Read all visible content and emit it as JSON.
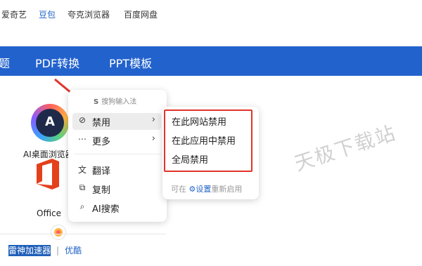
{
  "top_links": [
    {
      "label": "爱奇艺",
      "active": false
    },
    {
      "label": "豆包",
      "active": true
    },
    {
      "label": "夸克浏览器",
      "active": false
    },
    {
      "label": "百度网盘",
      "active": false
    }
  ],
  "nav": {
    "items": [
      "题",
      "PDF转换",
      "PPT模板"
    ],
    "color": "#2262cd"
  },
  "apps": [
    {
      "label": "AI桌面浏览器",
      "icon": "ai-browser-icon"
    },
    {
      "label": "Office",
      "icon": "office-icon"
    }
  ],
  "bottom_links": {
    "highlighted": "雷神加速器",
    "separator": "|",
    "link": "优酷"
  },
  "context_menu": {
    "header_icon": "S",
    "header": "搜狗输入法",
    "items": [
      {
        "icon": "forbid-icon",
        "icon_glyph": "⊘",
        "label": "禁用",
        "has_submenu": true
      },
      {
        "icon": "more-icon",
        "icon_glyph": "⋯",
        "label": "更多",
        "has_submenu": true
      },
      {
        "icon": "translate-icon",
        "icon_glyph": "文",
        "label": "翻译",
        "has_submenu": false
      },
      {
        "icon": "copy-icon",
        "icon_glyph": "⧉",
        "label": "复制",
        "has_submenu": false
      },
      {
        "icon": "ai-search-icon",
        "icon_glyph": "⌕",
        "label": "AI搜索",
        "has_submenu": false
      }
    ],
    "chevron": "›"
  },
  "submenu": {
    "items": [
      "在此网站禁用",
      "在此应用中禁用",
      "全局禁用"
    ],
    "footer_prefix": "可在",
    "footer_link": "设置",
    "footer_suffix": "重新启用"
  },
  "watermark": "天极下载站",
  "colors": {
    "accent": "#2163c7",
    "highlight_box": "#e0332a",
    "arrow": "#e0332a"
  }
}
